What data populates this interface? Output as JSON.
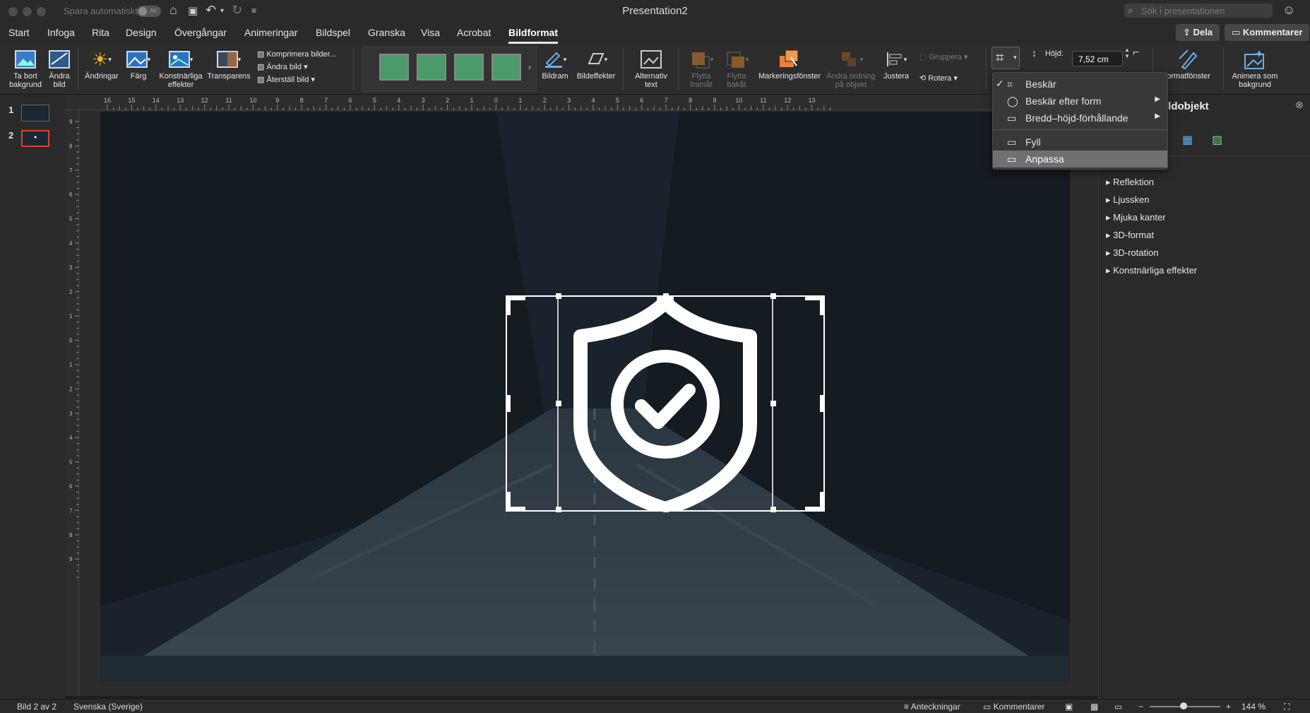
{
  "window": {
    "autosave_label": "Spara automatiskt",
    "autosave_state": "AV",
    "title": "Presentation2",
    "search_placeholder": "Sök i presentationen"
  },
  "tabs": [
    "Start",
    "Infoga",
    "Rita",
    "Design",
    "Övergångar",
    "Animeringar",
    "Bildspel",
    "Granska",
    "Visa",
    "Acrobat",
    "Bildformat"
  ],
  "active_tab": "Bildformat",
  "top_buttons": {
    "share": "Dela",
    "comments": "Kommentarer"
  },
  "ribbon": {
    "remove_bg": [
      "Ta bort",
      "bakgrund"
    ],
    "change_pic": [
      "Ändra",
      "bild"
    ],
    "corrections": "Ändringar",
    "color": "Färg",
    "artistic": [
      "Konstnärliga",
      "effekter"
    ],
    "transparency": "Transparens",
    "compress": "Komprimera bilder...",
    "change_picture": "Ändra bild",
    "reset_picture": "Återställ bild",
    "picture_border": "Bildram",
    "picture_effects": "Bildeffekter",
    "alt_text": [
      "Alternativ",
      "text"
    ],
    "bring_forward": [
      "Flytta",
      "framåt"
    ],
    "send_backward": [
      "Flytta",
      "bakåt"
    ],
    "selection_pane": "Markeringsfönster",
    "reorder": [
      "Ändra ordning",
      "på objekt"
    ],
    "align": "Justera",
    "group": "Gruppera",
    "rotate": "Rotera",
    "height_label": "Höjd:",
    "height_value": "7,52 cm",
    "format_pane": "ormatfönster",
    "animate_bg": [
      "Animera som",
      "bakgrund"
    ]
  },
  "crop_menu": {
    "items": [
      {
        "label": "Beskär",
        "checked": true
      },
      {
        "label": "Beskär efter form",
        "submenu": true
      },
      {
        "label": "Bredd–höjd-förhållande",
        "submenu": true
      },
      {
        "label": "Fyll"
      },
      {
        "label": "Anpassa",
        "highlighted": true
      }
    ]
  },
  "slides": [
    {
      "num": "1"
    },
    {
      "num": "2",
      "selected": true
    }
  ],
  "ruler_h": [
    "16",
    "15",
    "14",
    "13",
    "12",
    "11",
    "10",
    "9",
    "8",
    "7",
    "6",
    "5",
    "4",
    "3",
    "2",
    "1",
    "0",
    "1",
    "2",
    "3",
    "4",
    "5",
    "6",
    "7",
    "8",
    "9",
    "10",
    "11",
    "12",
    "13"
  ],
  "ruler_v": [
    "9",
    "8",
    "7",
    "6",
    "5",
    "4",
    "3",
    "2",
    "1",
    "0",
    "1",
    "2",
    "3",
    "4",
    "5",
    "6",
    "7",
    "8",
    "9"
  ],
  "format_pane_title": "ildobjekt",
  "format_sections": [
    "Reflektion",
    "Ljussken",
    "Mjuka kanter",
    "3D-format",
    "3D-rotation",
    "Konstnärliga effekter"
  ],
  "status": {
    "slide_info": "Bild 2 av 2",
    "language": "Svenska (Sverige)",
    "notes": "Anteckningar",
    "comments": "Kommentarer",
    "zoom": "144 %"
  },
  "zoom_level": 0.48,
  "colors": {
    "accent_orange": "#e8823a",
    "selected_slide": "#d9452b",
    "menu_highlight": "#707070"
  }
}
